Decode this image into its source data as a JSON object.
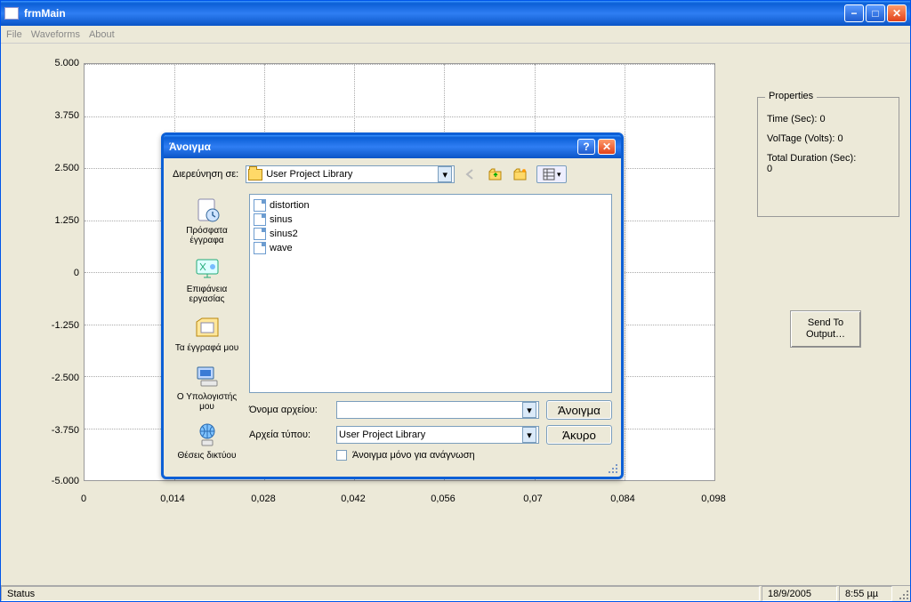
{
  "window": {
    "title": "frmMain"
  },
  "menu": {
    "file": "File",
    "waveforms": "Waveforms",
    "about": "About"
  },
  "chart_data": {
    "type": "line",
    "series": [],
    "x": [],
    "xlim": [
      0,
      0.098
    ],
    "ylim": [
      -5.0,
      5.0
    ],
    "xticks": [
      0,
      0.014,
      0.028,
      0.042,
      0.056,
      0.07,
      0.084,
      0.098
    ],
    "xtick_labels": [
      "0",
      "0,014",
      "0,028",
      "0,042",
      "0,056",
      "0,07",
      "0,084",
      "0,098"
    ],
    "yticks": [
      -5.0,
      -3.75,
      -2.5,
      -1.25,
      0,
      1.25,
      2.5,
      3.75,
      5.0
    ],
    "ytick_labels": [
      "-5.000",
      "-3.750",
      "-2.500",
      "-1.250",
      "0",
      "1.250",
      "2.500",
      "3.750",
      "5.000"
    ]
  },
  "properties": {
    "heading": "Properties",
    "time": "Time (Sec): 0",
    "voltage": "VolTage (Volts): 0",
    "duration_label": "Total Duration (Sec):",
    "duration_value": "0"
  },
  "send_button": "Send To Output…",
  "status": {
    "text": "Status",
    "date": "18/9/2005",
    "time": "8:55 µµ"
  },
  "dialog": {
    "title": "Άνοιγμα",
    "lookin_label": "Διερεύνηση σε:",
    "lookin_value": "User Project Library",
    "places": {
      "recent": "Πρόσφατα έγγραφα",
      "desktop": "Επιφάνεια εργασίας",
      "mydocs": "Τα έγγραφά μου",
      "mycomp": "Ο Υπολογιστής μου",
      "network": "Θέσεις δικτύου"
    },
    "files": [
      "distortion",
      "sinus",
      "sinus2",
      "wave"
    ],
    "filename_label": "Όνομα αρχείου:",
    "filename_value": "",
    "filetype_label": "Αρχεία τύπου:",
    "filetype_value": "User Project Library",
    "readonly_label": "Άνοιγμα μόνο για ανάγνωση",
    "open_btn": "Άνοιγμα",
    "cancel_btn": "Άκυρο"
  }
}
